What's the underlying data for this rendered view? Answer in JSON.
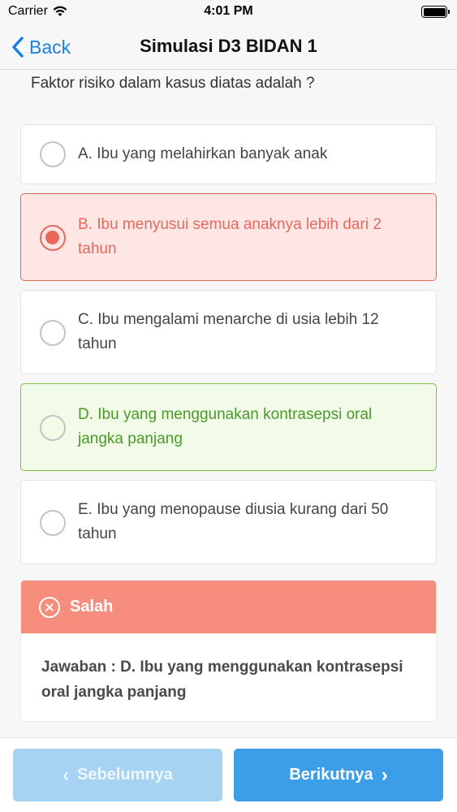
{
  "status_bar": {
    "carrier": "Carrier",
    "time": "4:01 PM"
  },
  "nav": {
    "back_label": "Back",
    "title": "Simulasi D3 BIDAN 1"
  },
  "question": "Faktor risiko dalam kasus diatas adalah ?",
  "options": [
    {
      "text": "A. Ibu yang melahirkan banyak anak",
      "state": "default"
    },
    {
      "text": "B. Ibu menyusui semua anaknya lebih dari 2 tahun",
      "state": "selected-wrong"
    },
    {
      "text": "C. Ibu mengalami menarche di usia lebih 12 tahun",
      "state": "default"
    },
    {
      "text": "D. Ibu yang menggunakan kontrasepsi oral jangka panjang",
      "state": "correct"
    },
    {
      "text": "E. Ibu yang menopause diusia kurang dari 50 tahun",
      "state": "default"
    }
  ],
  "feedback": {
    "status": "Salah",
    "answer": "Jawaban : D. Ibu yang menggunakan kontrasepsi oral jangka panjang"
  },
  "buttons": {
    "prev_label": "Sebelumnya",
    "next_label": "Berikutnya"
  },
  "colors": {
    "accent": "#1a7fe0",
    "wrong": "#e8695c",
    "correct": "#4a9a2a",
    "feedback_header": "#f68d7d",
    "next_button": "#3d9ee8",
    "prev_button": "#a7d3f3"
  },
  "icons": {
    "back": "chevron-left-icon",
    "wifi": "wifi-icon",
    "battery": "battery-icon",
    "feedback": "x-circle-icon",
    "prev": "chevron-left-icon",
    "next": "chevron-right-icon"
  }
}
